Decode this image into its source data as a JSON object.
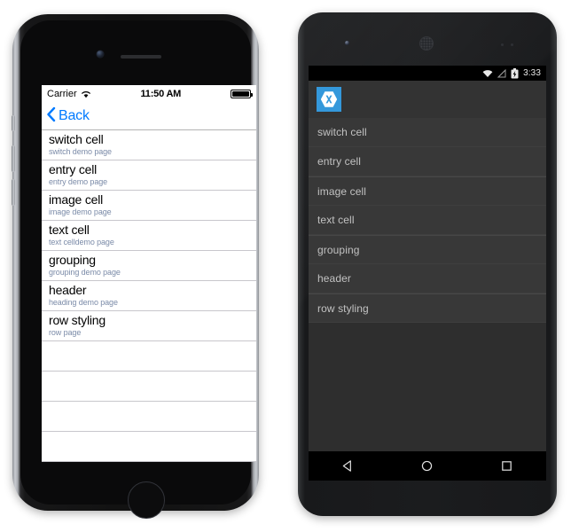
{
  "background_color": "#ffffff",
  "ios": {
    "device": "iphone",
    "status_bar": {
      "carrier": "Carrier",
      "wifi_icon": "wifi-icon",
      "time": "11:50 AM",
      "battery_icon": "battery-full-icon"
    },
    "nav_bar": {
      "back_icon": "chevron-left-icon",
      "back_label": "Back",
      "back_color": "#007aff"
    },
    "list": {
      "title_color": "#000000",
      "subtitle_color": "#7b8ba8",
      "separator_color": "#c8c7cc",
      "items": [
        {
          "title": "switch cell",
          "subtitle": "switch demo page"
        },
        {
          "title": "entry cell",
          "subtitle": "entry demo page"
        },
        {
          "title": "image cell",
          "subtitle": "image demo page"
        },
        {
          "title": "text cell",
          "subtitle": "text celldemo page"
        },
        {
          "title": "grouping",
          "subtitle": "grouping demo page"
        },
        {
          "title": "header",
          "subtitle": "heading demo page"
        },
        {
          "title": "row styling",
          "subtitle": "row page"
        }
      ],
      "empty_row_count": 5
    }
  },
  "android": {
    "device": "android-phone",
    "status_bar": {
      "wifi_icon": "wifi-icon",
      "signal_icon": "signal-icon",
      "battery_icon": "battery-charging-icon",
      "time": "3:33"
    },
    "app_bar": {
      "logo_icon": "xamarin-logo-icon",
      "logo_color": "#3498db",
      "background_color": "#333333"
    },
    "list": {
      "background_color": "#383838",
      "text_color": "#c2c2c2",
      "divider_color": "#3f3f3f",
      "items": [
        {
          "title": "switch cell",
          "group_start": false
        },
        {
          "title": "entry cell",
          "group_start": false
        },
        {
          "title": "image cell",
          "group_start": true
        },
        {
          "title": "text cell",
          "group_start": false
        },
        {
          "title": "grouping",
          "group_start": true
        },
        {
          "title": "header",
          "group_start": false
        },
        {
          "title": "row styling",
          "group_start": true
        }
      ]
    },
    "nav_bar": {
      "back_icon": "back-triangle-icon",
      "home_icon": "home-circle-icon",
      "recents_icon": "recents-square-icon"
    }
  }
}
